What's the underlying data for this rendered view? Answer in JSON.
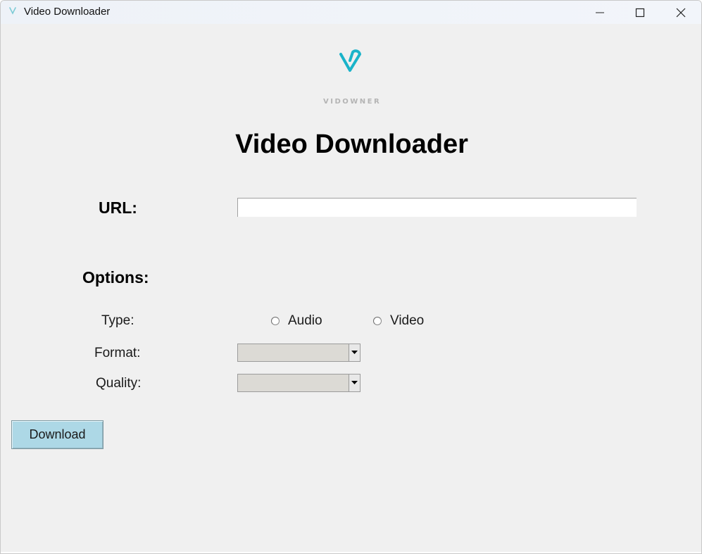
{
  "window": {
    "title": "Video Downloader",
    "icon": "vidowner-app-icon",
    "controls": [
      "minimize-icon",
      "maximize-icon",
      "close-icon"
    ]
  },
  "logo": {
    "icon": "vidowner-logo-icon",
    "wordmark": "VIDOWNER",
    "color": "#1ab3c9"
  },
  "heading": "Video Downloader",
  "url": {
    "label": "URL:",
    "value": "",
    "placeholder": ""
  },
  "options": {
    "label": "Options:",
    "type": {
      "label": "Type:",
      "choices": [
        {
          "label": "Audio",
          "selected": false
        },
        {
          "label": "Video",
          "selected": false
        }
      ]
    },
    "format": {
      "label": "Format:",
      "selected": ""
    },
    "quality": {
      "label": "Quality:",
      "selected": ""
    }
  },
  "download_button": {
    "label": "Download",
    "color": "#add8e6"
  }
}
